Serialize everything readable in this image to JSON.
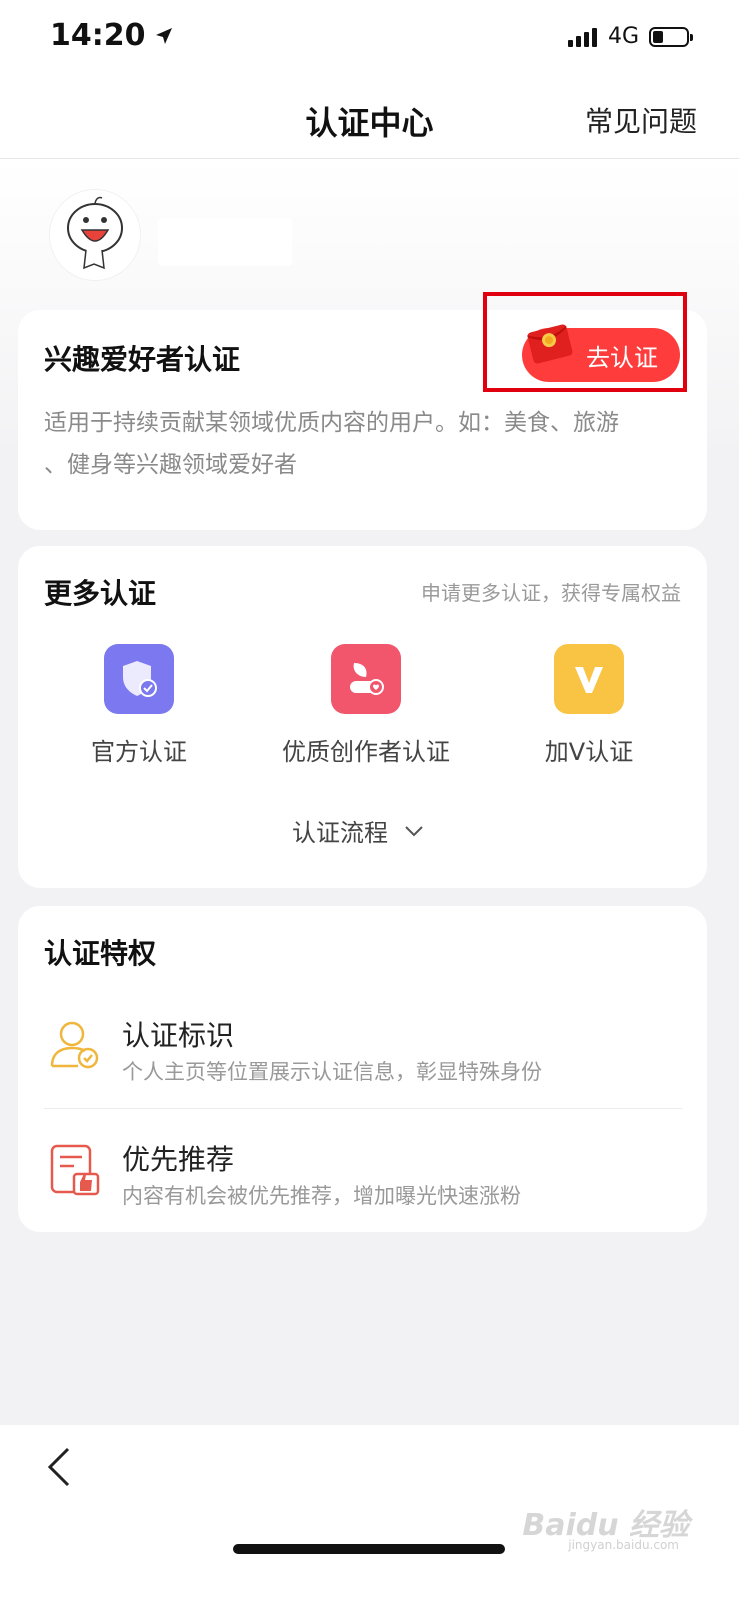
{
  "status_bar": {
    "time": "14:20",
    "network": "4G"
  },
  "header": {
    "title": "认证中心",
    "faq_label": "常见问题"
  },
  "interest_card": {
    "title": "兴趣爱好者认证",
    "button_label": "去认证",
    "description_line1": "适用于持续贡献某领域优质内容的用户。如：美食、旅游",
    "description_line2": "、健身等兴趣领域爱好者"
  },
  "more_card": {
    "title": "更多认证",
    "subtitle": "申请更多认证，获得专属权益",
    "items": [
      {
        "label": "官方认证",
        "icon": "shield-check-icon",
        "color": "#7b78f0"
      },
      {
        "label": "优质创作者认证",
        "icon": "creator-icon",
        "color": "#f2566d"
      },
      {
        "label": "加V认证",
        "icon": "v-badge-icon",
        "color": "#f9c343"
      }
    ],
    "flow_label": "认证流程"
  },
  "privileges_card": {
    "title": "认证特权",
    "items": [
      {
        "title": "认证标识",
        "desc": "个人主页等位置展示认证信息，彰显特殊身份",
        "icon": "user-check-icon",
        "color": "#f0b63c"
      },
      {
        "title": "优先推荐",
        "desc": "内容有机会被优先推荐，增加曝光快速涨粉",
        "icon": "thumbs-up-doc-icon",
        "color": "#e65a4e"
      }
    ]
  },
  "watermark": {
    "brand": "Baidu 经验",
    "url": "jingyan.baidu.com"
  },
  "colors": {
    "accent_red": "#ff3c3c",
    "highlight_red": "#e00010"
  }
}
